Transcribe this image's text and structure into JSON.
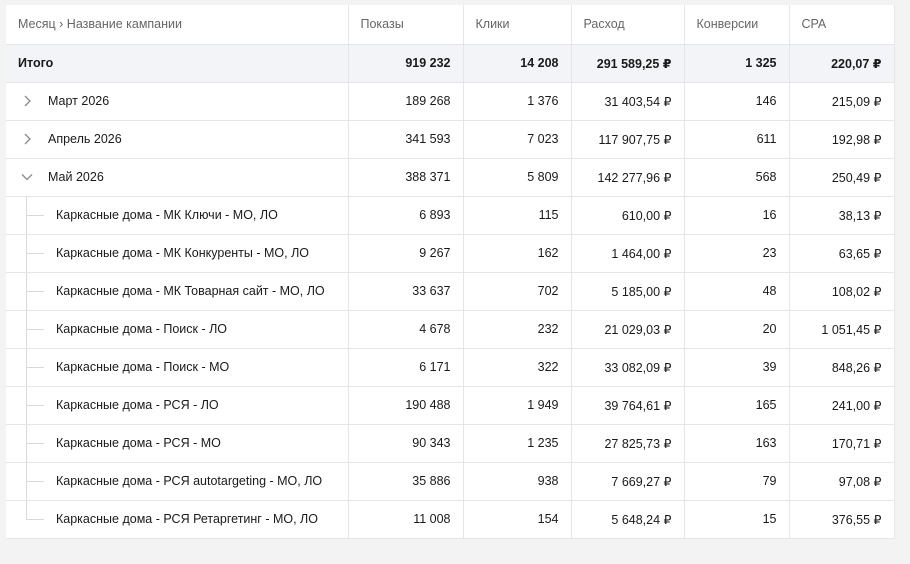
{
  "header": {
    "name": "Месяц › Название кампании",
    "shows": "Показы",
    "clicks": "Клики",
    "cost": "Расход",
    "conversions": "Конверсии",
    "cpa": "CPA"
  },
  "total": {
    "label": "Итого",
    "shows": "919 232",
    "clicks": "14 208",
    "cost": "291 589,25 ₽",
    "conversions": "1 325",
    "cpa": "220,07 ₽"
  },
  "months": [
    {
      "label": "Март 2026",
      "expanded": false,
      "shows": "189 268",
      "clicks": "1 376",
      "cost": "31 403,54 ₽",
      "conversions": "146",
      "cpa": "215,09 ₽"
    },
    {
      "label": "Апрель 2026",
      "expanded": false,
      "shows": "341 593",
      "clicks": "7 023",
      "cost": "117 907,75 ₽",
      "conversions": "611",
      "cpa": "192,98 ₽"
    },
    {
      "label": "Май 2026",
      "expanded": true,
      "shows": "388 371",
      "clicks": "5 809",
      "cost": "142 277,96 ₽",
      "conversions": "568",
      "cpa": "250,49 ₽"
    }
  ],
  "campaigns": [
    {
      "name": "Каркасные дома - МК Ключи - МО, ЛО",
      "shows": "6 893",
      "clicks": "115",
      "cost": "610,00 ₽",
      "conversions": "16",
      "cpa": "38,13 ₽"
    },
    {
      "name": "Каркасные дома - МК Конкуренты - МО, ЛО",
      "shows": "9 267",
      "clicks": "162",
      "cost": "1 464,00 ₽",
      "conversions": "23",
      "cpa": "63,65 ₽"
    },
    {
      "name": "Каркасные дома - МК Товарная сайт - МО, ЛО",
      "shows": "33 637",
      "clicks": "702",
      "cost": "5 185,00 ₽",
      "conversions": "48",
      "cpa": "108,02 ₽"
    },
    {
      "name": "Каркасные дома - Поиск - ЛО",
      "shows": "4 678",
      "clicks": "232",
      "cost": "21 029,03 ₽",
      "conversions": "20",
      "cpa": "1 051,45 ₽"
    },
    {
      "name": "Каркасные дома - Поиск - МО",
      "shows": "6 171",
      "clicks": "322",
      "cost": "33 082,09 ₽",
      "conversions": "39",
      "cpa": "848,26 ₽"
    },
    {
      "name": "Каркасные дома - РСЯ - ЛО",
      "shows": "190 488",
      "clicks": "1 949",
      "cost": "39 764,61 ₽",
      "conversions": "165",
      "cpa": "241,00 ₽"
    },
    {
      "name": "Каркасные дома - РСЯ - МО",
      "shows": "90 343",
      "clicks": "1 235",
      "cost": "27 825,73 ₽",
      "conversions": "163",
      "cpa": "170,71 ₽"
    },
    {
      "name": "Каркасные дома - РСЯ autotargeting - МО, ЛО",
      "shows": "35 886",
      "clicks": "938",
      "cost": "7 669,27 ₽",
      "conversions": "79",
      "cpa": "97,08 ₽"
    },
    {
      "name": "Каркасные дома - РСЯ Ретаргетинг - МО, ЛО",
      "shows": "11 008",
      "clicks": "154",
      "cost": "5 648,24 ₽",
      "conversions": "15",
      "cpa": "376,55 ₽"
    }
  ]
}
